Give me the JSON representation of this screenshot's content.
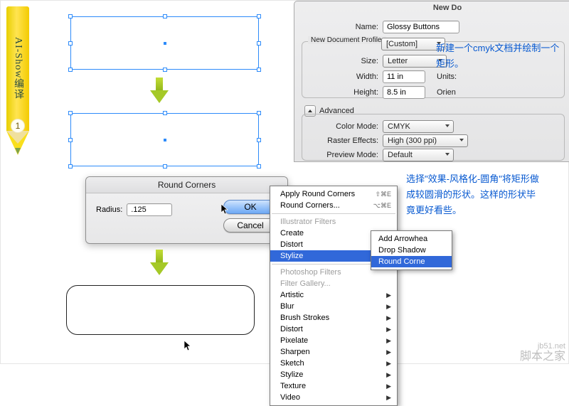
{
  "pencil": {
    "label": "AI-Show编译",
    "step": "1"
  },
  "panel": {
    "title": "New Do",
    "name_label": "Name:",
    "name_value": "Glossy Buttons",
    "profile_group": "New Document Profile:",
    "profile_value": "[Custom]",
    "size_label": "Size:",
    "size_value": "Letter",
    "width_label": "Width:",
    "width_value": "11 in",
    "units_label": "Units:",
    "height_label": "Height:",
    "height_value": "8.5 in",
    "orient_label": "Orien",
    "advanced": "Advanced",
    "colormode_label": "Color Mode:",
    "colormode_value": "CMYK",
    "raster_label": "Raster Effects:",
    "raster_value": "High (300 ppi)",
    "preview_label": "Preview Mode:",
    "preview_value": "Default"
  },
  "instr1": "新建一个cmyk文档并绘制一个矩形。",
  "instr2": "选择\"效果-风格化-圆角\"将矩形做成较圆滑的形状。这样的形状毕竟更好看些。",
  "rc": {
    "title": "Round Corners",
    "radius_label": "Radius:",
    "radius_value": ".125",
    "ok": "OK",
    "cancel": "Cancel"
  },
  "menu": {
    "apply": "Apply Round Corners",
    "apply_sc": "⇧⌘E",
    "last": "Round Corners...",
    "last_sc": "⌥⌘E",
    "group1": "Illustrator Filters",
    "items1": [
      "Create",
      "Distort",
      "Stylize"
    ],
    "group2": "Photoshop Filters",
    "gallery": "Filter Gallery...",
    "items2": [
      "Artistic",
      "Blur",
      "Brush Strokes",
      "Distort",
      "Pixelate",
      "Sharpen",
      "Sketch",
      "Stylize",
      "Texture",
      "Video"
    ]
  },
  "submenu": [
    "Add Arrowhea",
    "Drop Shadow",
    "Round Corne"
  ],
  "watermark": {
    "en": "jb51.net",
    "zh": "脚本之家"
  }
}
